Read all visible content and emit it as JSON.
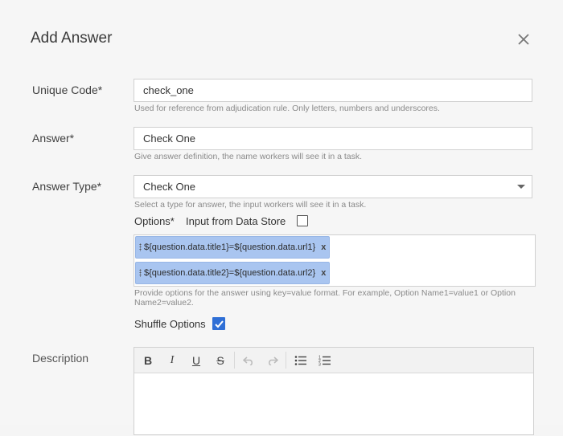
{
  "dialog": {
    "title": "Add Answer",
    "close_icon": "close-icon"
  },
  "fields": {
    "unique_code": {
      "label": "Unique Code*",
      "value": "check_one",
      "hint": "Used for reference from adjudication rule. Only letters, numbers and underscores."
    },
    "answer": {
      "label": "Answer*",
      "value": "Check One",
      "hint": "Give answer definition, the name workers will see it in a task."
    },
    "answer_type": {
      "label": "Answer Type*",
      "value": "Check One",
      "hint": "Select a type for answer, the input workers will see it in a task."
    },
    "options": {
      "label": "Options*",
      "data_store_label": "Input from Data Store",
      "data_store_checked": false,
      "tags": [
        {
          "text": "${question.data.title1}=${question.data.url1}",
          "remove": "x"
        },
        {
          "text": "${question.data.title2}=${question.data.url2}",
          "remove": "x"
        }
      ],
      "hint_line1": "Provide options for the answer using key=value format. For example, Option Name1=value1 or Option",
      "hint_line2": "Name2=value2."
    },
    "shuffle": {
      "label": "Shuffle Options",
      "checked": true
    },
    "description": {
      "label": "Description",
      "toolbar": [
        "bold-icon",
        "italic-icon",
        "underline-icon",
        "strikethrough-icon",
        "undo-icon",
        "redo-icon",
        "bullet-list-icon",
        "numbered-list-icon"
      ]
    }
  },
  "colors": {
    "accent": "#2f6fd6",
    "tag_bg": "#a9c5f0"
  }
}
